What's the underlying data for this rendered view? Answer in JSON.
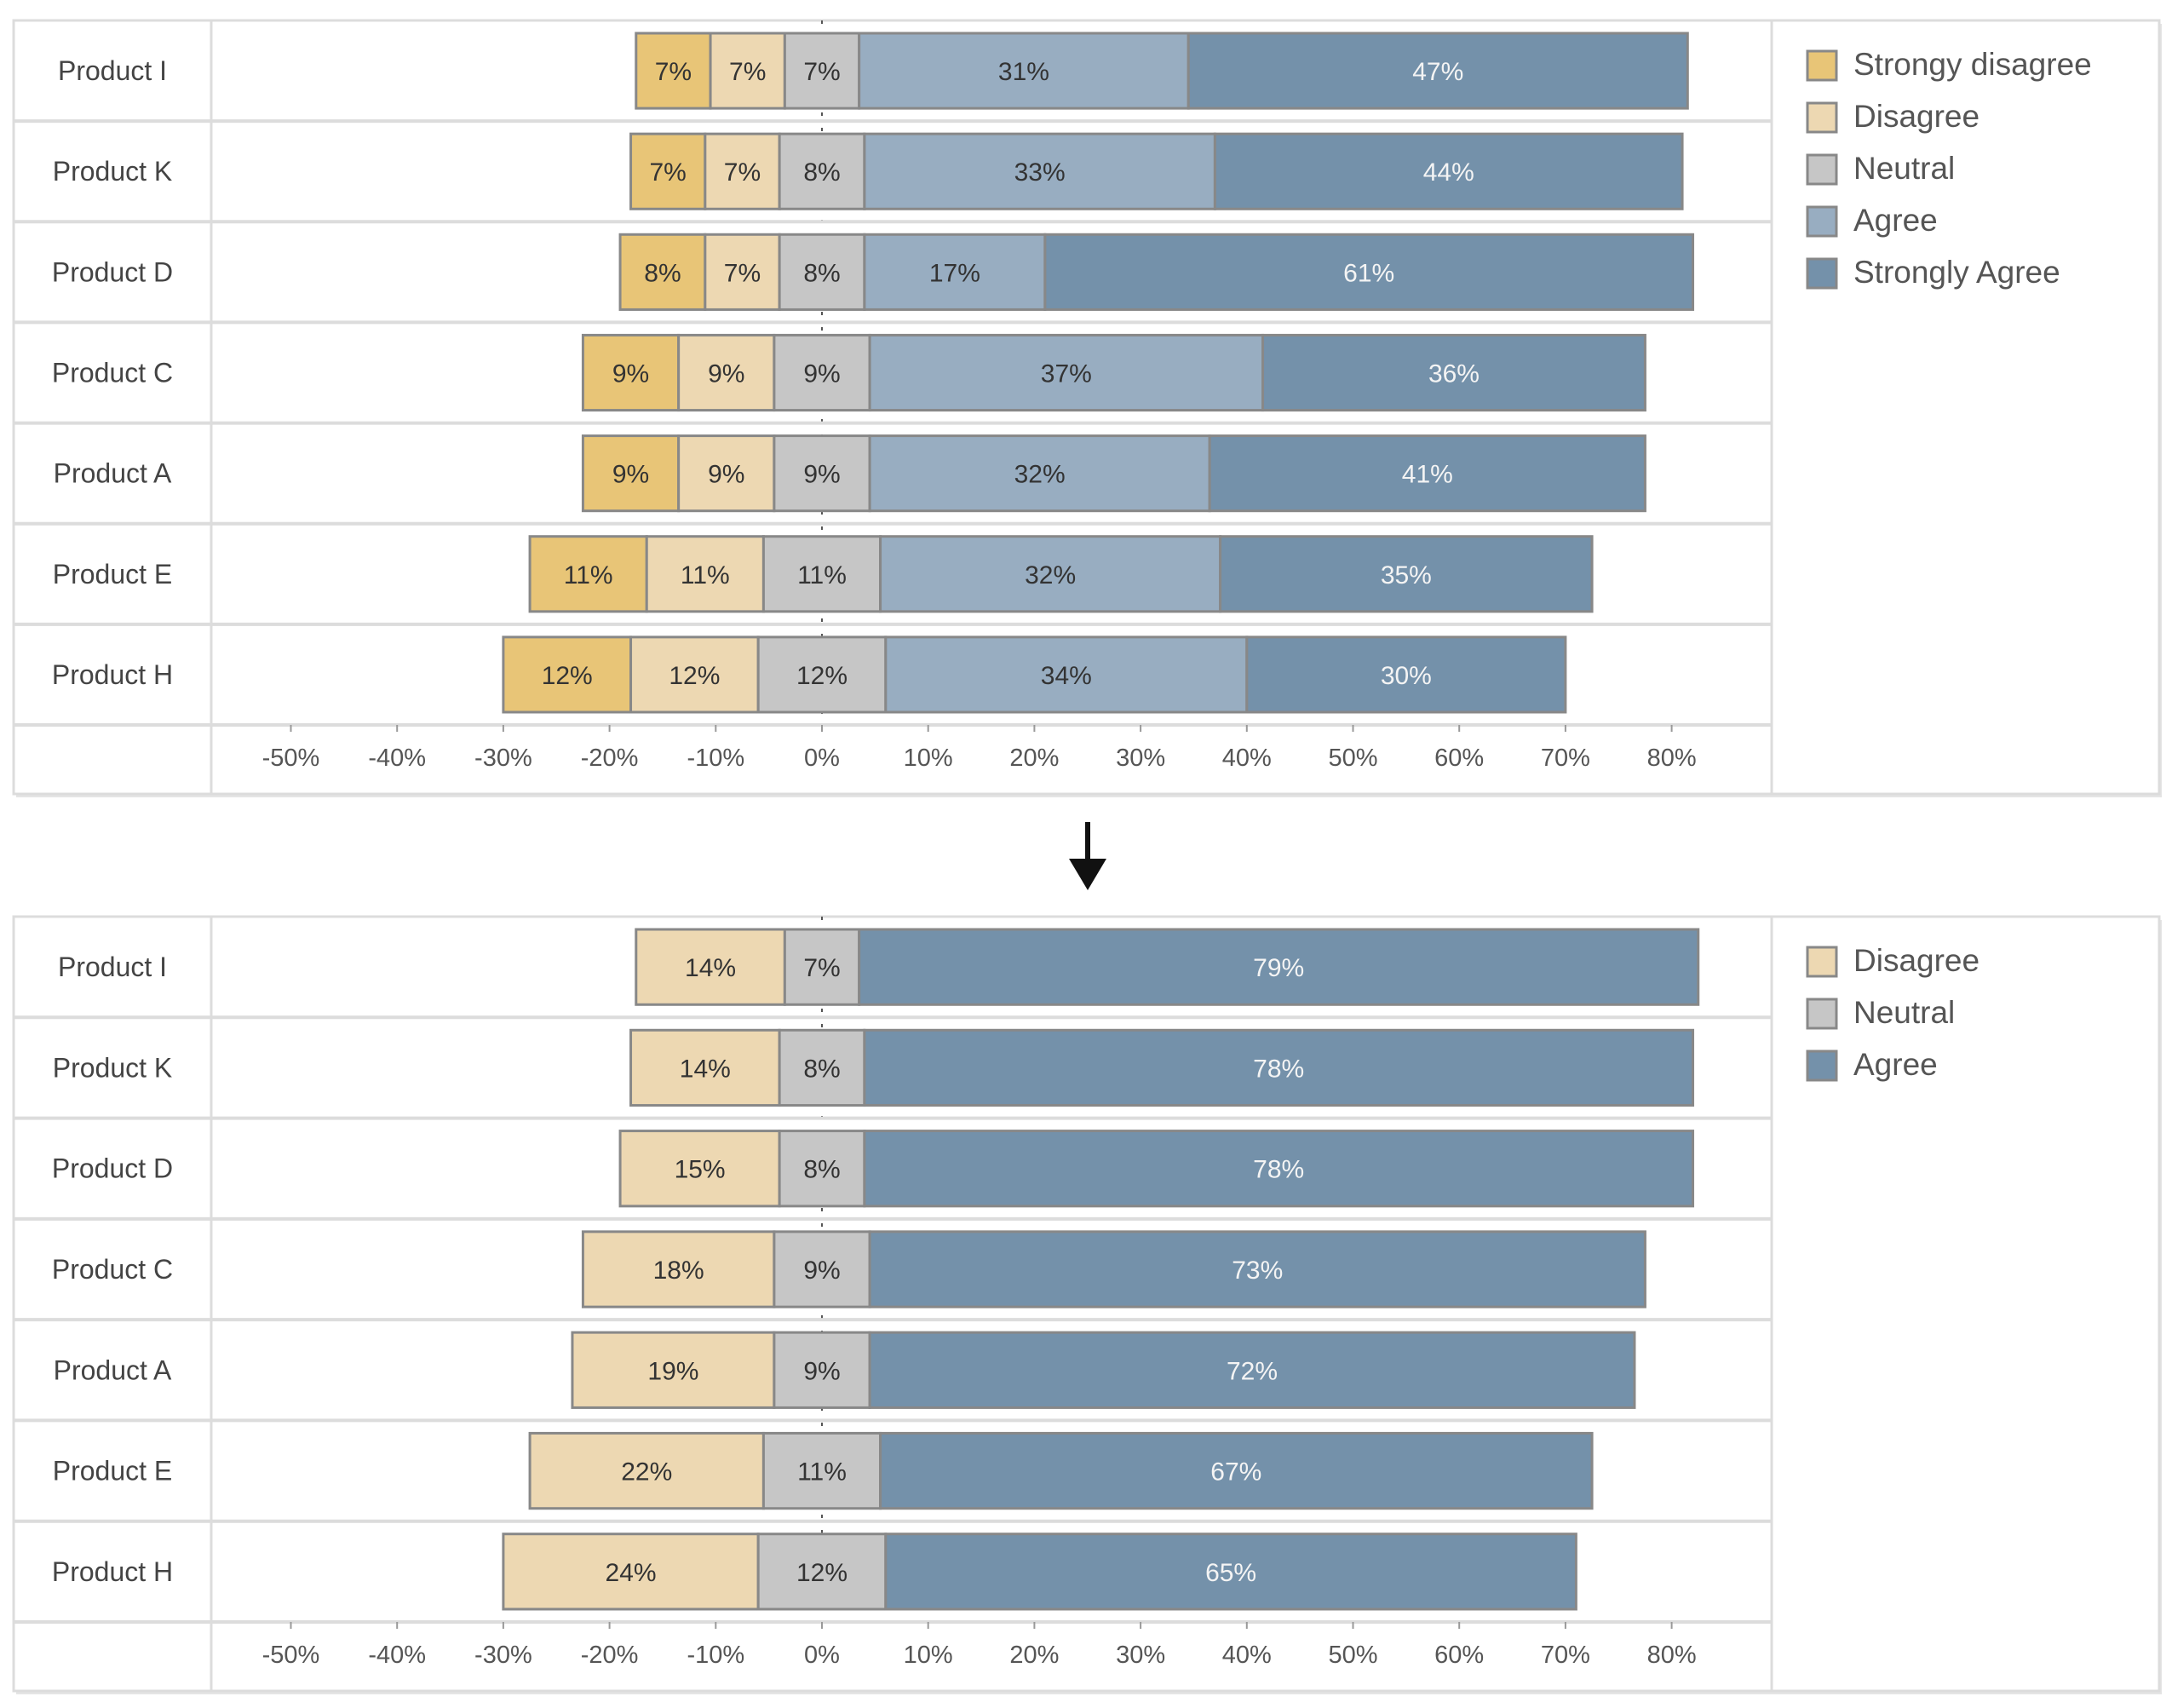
{
  "chart_data": [
    {
      "type": "bar",
      "orientation": "horizontal-diverging-stacked",
      "categories": [
        "Product I",
        "Product K",
        "Product D",
        "Product C",
        "Product A",
        "Product E",
        "Product H"
      ],
      "series": [
        {
          "name": "Strongy disagree",
          "color": "#E8C577",
          "values": [
            7,
            7,
            8,
            9,
            9,
            11,
            12
          ]
        },
        {
          "name": "Disagree",
          "color": "#EDD8B2",
          "values": [
            7,
            7,
            7,
            9,
            9,
            11,
            12
          ]
        },
        {
          "name": "Neutral",
          "color": "#C6C6C6",
          "values": [
            7,
            8,
            8,
            9,
            9,
            11,
            12
          ]
        },
        {
          "name": "Agree",
          "color": "#98ADC1",
          "values": [
            31,
            33,
            17,
            37,
            32,
            32,
            34
          ]
        },
        {
          "name": "Strongly Agree",
          "color": "#7491AA",
          "values": [
            47,
            44,
            61,
            36,
            41,
            35,
            30
          ]
        }
      ],
      "xticks": [
        "-50%",
        "-40%",
        "-30%",
        "-20%",
        "-10%",
        "0%",
        "10%",
        "20%",
        "30%",
        "40%",
        "50%",
        "60%",
        "70%",
        "80%"
      ],
      "xlim": [
        -57,
        89
      ],
      "legend": "right"
    },
    {
      "type": "bar",
      "orientation": "horizontal-diverging-stacked",
      "categories": [
        "Product I",
        "Product K",
        "Product D",
        "Product C",
        "Product A",
        "Product E",
        "Product H"
      ],
      "series": [
        {
          "name": "Disagree",
          "color": "#EDD8B2",
          "values": [
            14,
            14,
            15,
            18,
            19,
            22,
            24
          ]
        },
        {
          "name": "Neutral",
          "color": "#C6C6C6",
          "values": [
            7,
            8,
            8,
            9,
            9,
            11,
            12
          ]
        },
        {
          "name": "Agree",
          "color": "#7491AA",
          "values": [
            79,
            78,
            78,
            73,
            72,
            67,
            65
          ]
        }
      ],
      "xticks": [
        "-50%",
        "-40%",
        "-30%",
        "-20%",
        "-10%",
        "0%",
        "10%",
        "20%",
        "30%",
        "40%",
        "50%",
        "60%",
        "70%",
        "80%"
      ],
      "xlim": [
        -57,
        89
      ],
      "legend": "right"
    }
  ],
  "arrow_icon": "arrow-down-icon"
}
